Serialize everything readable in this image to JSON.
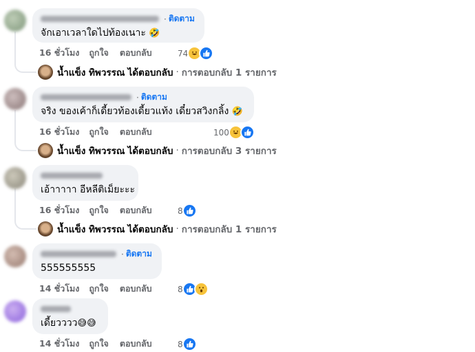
{
  "comments": [
    {
      "follow": "ติดตาม",
      "text": "จักเอาเวลาใดไปท้องเนาะ",
      "emoji": "🤣",
      "time": "16 ชั่วโมง",
      "like_label": "ถูกใจ",
      "reply_label": "ตอบกลับ",
      "reaction_count": "74",
      "reactions": [
        "haha-icon",
        "like-icon"
      ],
      "reply": {
        "name": "น้ำแข็ง ทิพวรรณ",
        "verb": "ได้ตอบกลับ",
        "sep": "·",
        "count": "การตอบกลับ 1 รายการ"
      }
    },
    {
      "follow": "ติดตาม",
      "text": "จริง ของเค้าก็เดี้ยวท้องเดี้ยวแท้ง เดี๋ยวสวิงกลิ้ง",
      "emoji": "🤣",
      "time": "16 ชั่วโมง",
      "like_label": "ถูกใจ",
      "reply_label": "ตอบกลับ",
      "reaction_count": "100",
      "reactions": [
        "haha-icon",
        "like-icon"
      ],
      "reply": {
        "name": "น้ำแข็ง ทิพวรรณ",
        "verb": "ได้ตอบกลับ",
        "sep": "·",
        "count": "การตอบกลับ 3 รายการ"
      }
    },
    {
      "follow": "",
      "text": "เอ้าาาาา อีหลีติเม็ยะะะ",
      "emoji": "",
      "time": "16 ชั่วโมง",
      "like_label": "ถูกใจ",
      "reply_label": "ตอบกลับ",
      "reaction_count": "8",
      "reactions": [
        "like-icon"
      ],
      "reply": {
        "name": "น้ำแข็ง ทิพวรรณ",
        "verb": "ได้ตอบกลับ",
        "sep": "·",
        "count": "การตอบกลับ 1 รายการ"
      }
    },
    {
      "follow": "ติดตาม",
      "text": "555555555",
      "emoji": "",
      "time": "14 ชั่วโมง",
      "like_label": "ถูกใจ",
      "reply_label": "ตอบกลับ",
      "reaction_count": "8",
      "reactions": [
        "like-icon",
        "wow-icon"
      ]
    },
    {
      "follow": "",
      "text": "เดี้ยวววว",
      "emoji": "😅😅",
      "time": "14 ชั่วโมง",
      "like_label": "ถูกใจ",
      "reply_label": "ตอบกลับ",
      "reaction_count": "8",
      "reactions": [
        "like-icon"
      ]
    }
  ],
  "colors": {
    "accent": "#1877f2",
    "bubble": "#f0f2f5",
    "meta": "#65676b",
    "haha": "#f7c33b"
  }
}
